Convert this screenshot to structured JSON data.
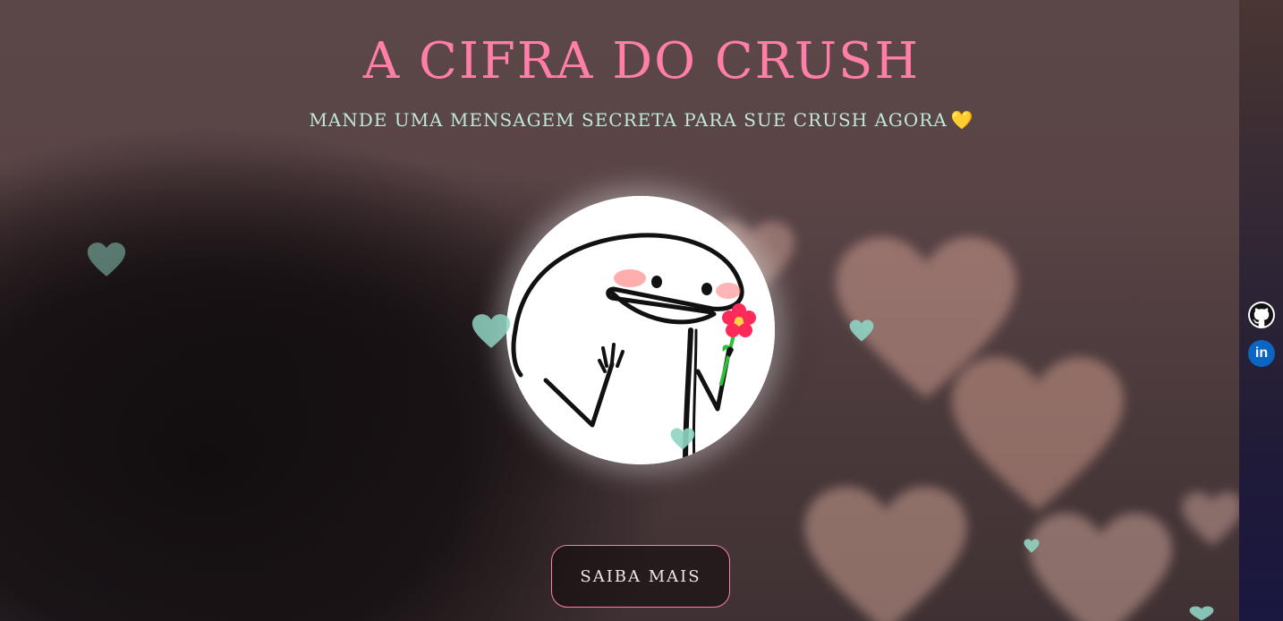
{
  "hero": {
    "title": "A CIFRA DO CRUSH",
    "subtitle": "MANDE UMA MENSAGEM SECRETA PARA SUE CRUSH AGORA",
    "subtitle_emoji": "💛",
    "cta_label": "SAIBA MAIS"
  },
  "social": {
    "github_label": "GitHub",
    "linkedin_label": "in"
  },
  "colors": {
    "title": "#ff7fa8",
    "subtitle": "#bfe8d8",
    "button_border": "#ff7fa8",
    "heart": "#8fd3c2",
    "linkedin": "#0a66c2"
  },
  "icons": {
    "avatar": "flork-with-flower-illustration",
    "hearts": "heart-icon",
    "github": "github-icon",
    "linkedin": "linkedin-icon"
  }
}
